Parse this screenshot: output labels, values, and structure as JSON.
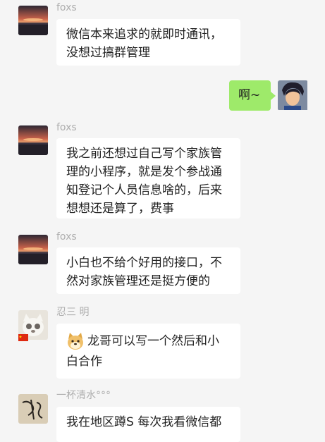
{
  "messages": [
    {
      "sender": "foxs",
      "avatar": "sunset-lake-avatar",
      "lines": [
        "微信本来追求的就即时通讯，",
        "没想过搞群管理"
      ]
    },
    {
      "sender": "self",
      "avatar": "cartoon-prince-avatar",
      "lines": [
        "啊~"
      ]
    },
    {
      "sender": "foxs",
      "avatar": "sunset-lake-avatar",
      "lines": [
        "我之前还想过自己写个家族管",
        "理的小程序，就是发个参战通",
        "知登记个人员信息啥的，后来",
        "想想还是算了，费事"
      ]
    },
    {
      "sender": "foxs",
      "avatar": "sunset-lake-avatar",
      "lines": [
        "小白也不给个好用的接口，不",
        "然对家族管理还是挺方便的"
      ]
    },
    {
      "sender": "忍三 明",
      "avatar": "white-cat-avatar",
      "badge": "china-flag-icon",
      "emoji": "doge-emoji",
      "lines": [
        "龙哥可以写一个然后和小",
        "白合作"
      ]
    },
    {
      "sender": "一杯清水°°°",
      "avatar": "calligraphy-avatar",
      "lines": [
        "我在地区蹲S 每次我看微信都"
      ]
    }
  ],
  "colors": {
    "background": "#f5f5f5",
    "self_bubble": "#9eea6a",
    "other_bubble": "#ffffff",
    "name": "#aeaeae"
  }
}
